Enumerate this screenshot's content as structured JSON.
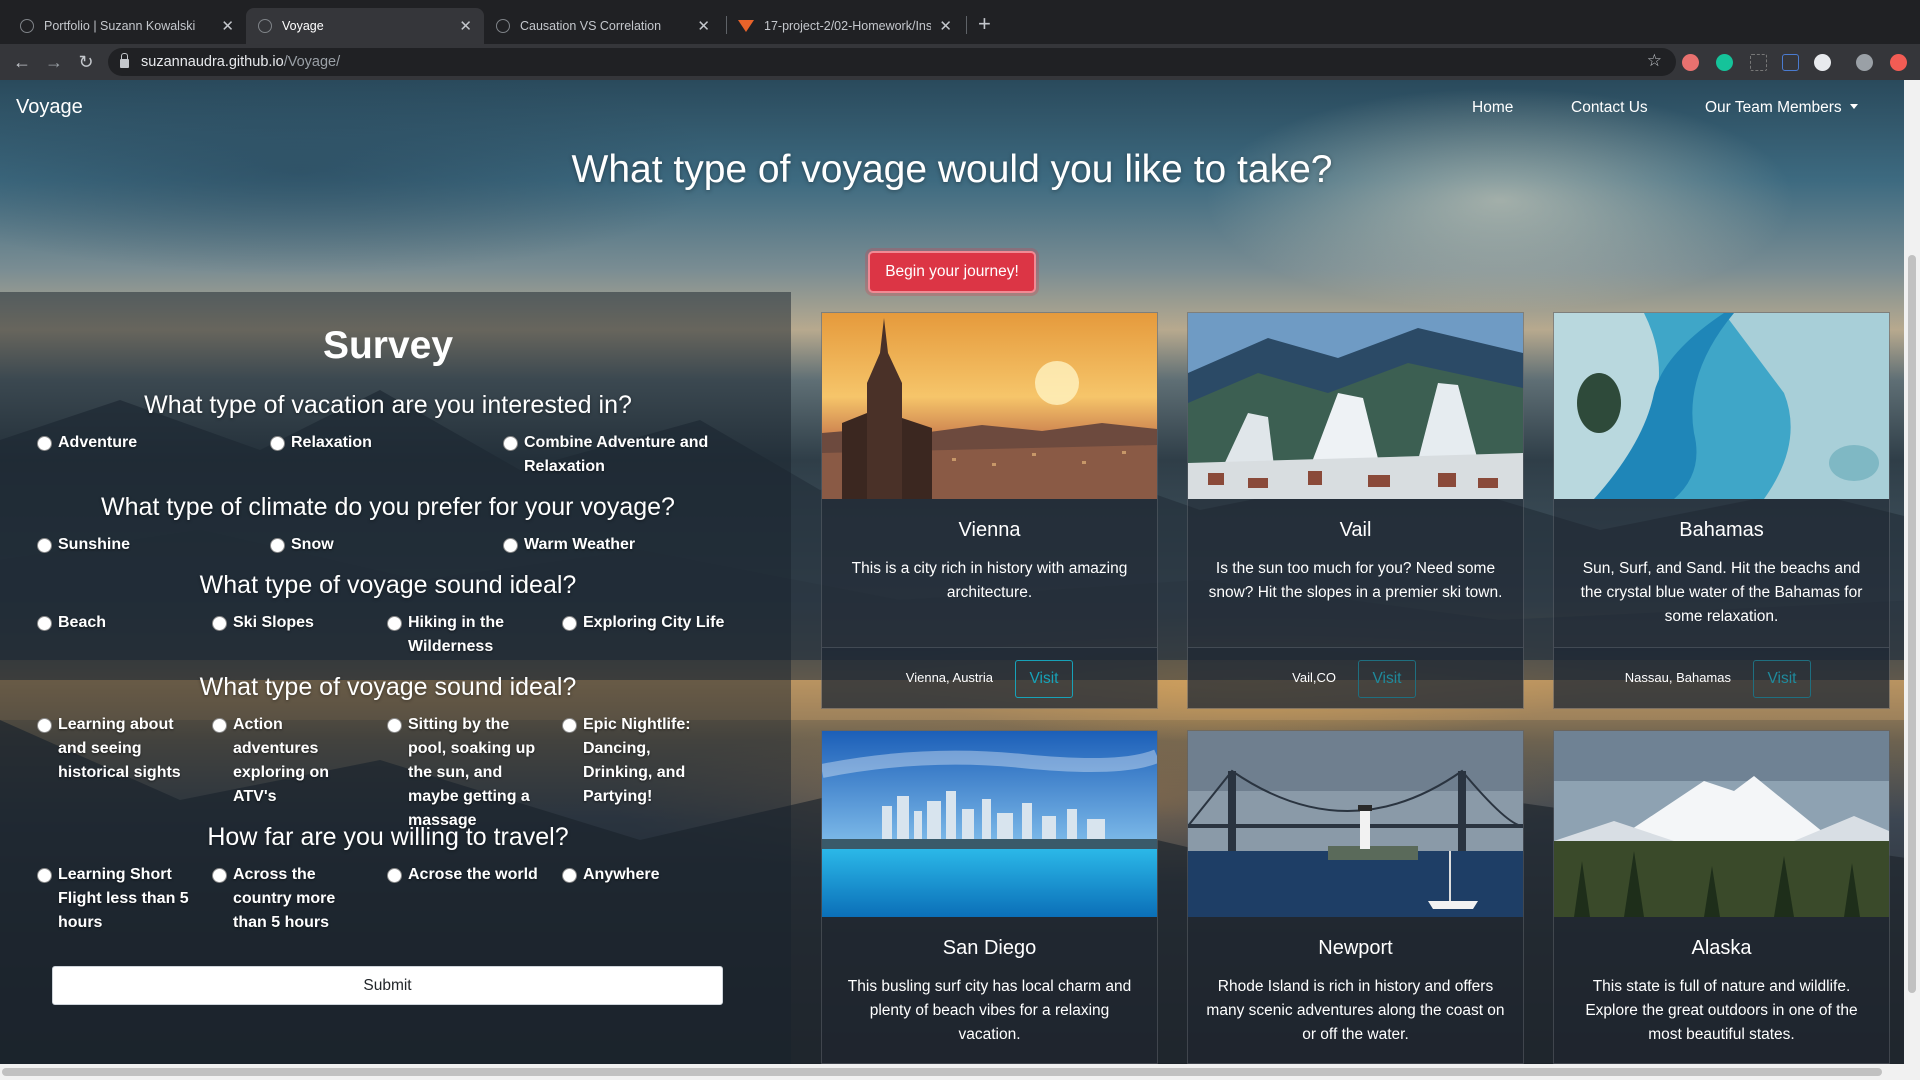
{
  "browser": {
    "tabs": [
      {
        "title": "Portfolio | Suzann Kowalski"
      },
      {
        "title": "Voyage"
      },
      {
        "title": "Causation VS Correlation"
      },
      {
        "title": "17-project-2/02-Homework/Inst"
      }
    ],
    "url_host": "suzannaudra.github.io",
    "url_path": "/Voyage/"
  },
  "nav": {
    "brand": "Voyage",
    "links": [
      "Home",
      "Contact Us",
      "Our Team Members"
    ]
  },
  "hero": {
    "headline": "What type of voyage would you like to take?",
    "cta": "Begin your journey!"
  },
  "survey": {
    "title": "Survey",
    "questions": [
      {
        "text": "What type of vacation are you interested in?",
        "options": [
          "Adventure",
          "Relaxation",
          "Combine Adventure and Relaxation"
        ]
      },
      {
        "text": "What type of climate do you prefer for your voyage?",
        "options": [
          "Sunshine",
          "Snow",
          "Warm Weather"
        ]
      },
      {
        "text": "What type of voyage sound ideal?",
        "options": [
          "Beach",
          "Ski Slopes",
          "Hiking in the Wilderness",
          "Exploring City Life"
        ]
      },
      {
        "text": "What type of voyage sound ideal?",
        "options": [
          "Learning about and seeing historical sights",
          "Action adventures exploring on ATV's",
          "Sitting by the pool, soaking up the sun, and maybe getting a massage",
          "Epic Nightlife: Dancing, Drinking, and Partying!"
        ]
      },
      {
        "text": "How far are you willing to travel?",
        "options": [
          "Learning Short Flight less than 5 hours",
          "Across the country more than 5 hours",
          "Acrose the world",
          "Anywhere"
        ]
      }
    ],
    "submit": "Submit"
  },
  "destinations": [
    {
      "name": "Vienna",
      "desc": "This is a city rich in history with amazing architecture.",
      "place": "Vienna, Austria",
      "visit": "Visit"
    },
    {
      "name": "Vail",
      "desc": "Is the sun too much for you? Need some snow? Hit the slopes in a premier ski town.",
      "place": "Vail,CO",
      "visit": "Visit"
    },
    {
      "name": "Bahamas",
      "desc": "Sun, Surf, and Sand. Hit the beachs and the crystal blue water of the Bahamas for some relaxation.",
      "place": "Nassau, Bahamas",
      "visit": "Visit"
    },
    {
      "name": "San Diego",
      "desc": "This busling surf city has local charm and plenty of beach vibes for a relaxing vacation."
    },
    {
      "name": "Newport",
      "desc": "Rhode Island is rich in history and offers many scenic adventures along the coast on or off the water."
    },
    {
      "name": "Alaska",
      "desc": "This state is full of nature and wildlife. Explore the great outdoors in one of the most beautiful states."
    }
  ]
}
